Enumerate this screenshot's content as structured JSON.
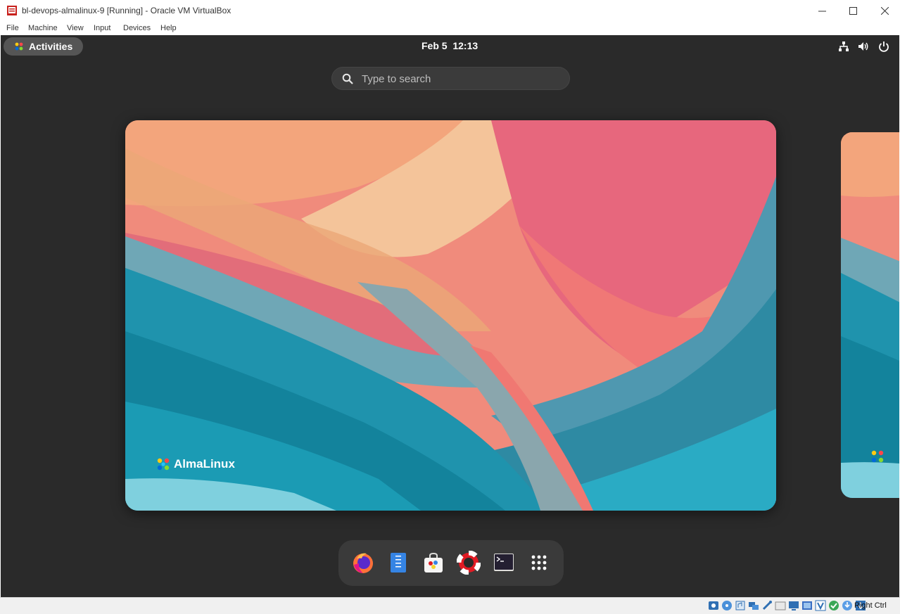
{
  "window": {
    "title": "bl-devops-almalinux-9 [Running] - Oracle VM VirtualBox",
    "menu": [
      "File",
      "Machine",
      "View",
      "Input",
      "Devices",
      "Help"
    ]
  },
  "gnome": {
    "activities_label": "Activities",
    "clock": "Feb 5  12:13",
    "search": {
      "placeholder": "Type to search",
      "value": ""
    },
    "wallpaper_brand": "AlmaLinux",
    "dash": [
      {
        "name": "Firefox",
        "icon": "firefox-icon"
      },
      {
        "name": "Text Editor",
        "icon": "text-editor-icon"
      },
      {
        "name": "Software",
        "icon": "software-icon"
      },
      {
        "name": "Help",
        "icon": "help-icon"
      },
      {
        "name": "Terminal",
        "icon": "terminal-icon"
      },
      {
        "name": "Show Applications",
        "icon": "app-grid-icon"
      }
    ],
    "tray": [
      "network-icon",
      "volume-icon",
      "power-icon"
    ]
  },
  "status_bar": {
    "host_key": "Right Ctrl",
    "icons": [
      "hard-disk-icon",
      "optical-drive-icon",
      "audio-icon",
      "network-adapter-icon",
      "usb-icon",
      "shared-folders-icon",
      "display-icon",
      "video-capture-icon",
      "recording-icon",
      "virtualization-icon",
      "mouse-integration-icon",
      "host-key-arrow-icon"
    ]
  },
  "colors": {
    "shell_background": "#2a2a2a",
    "activities_pill": "#555555",
    "dash_background": "#3a3a3a",
    "wallpaper_teal": "#1a8ea3",
    "wallpaper_coral": "#f07e7a",
    "wallpaper_peach": "#f4b07a"
  }
}
